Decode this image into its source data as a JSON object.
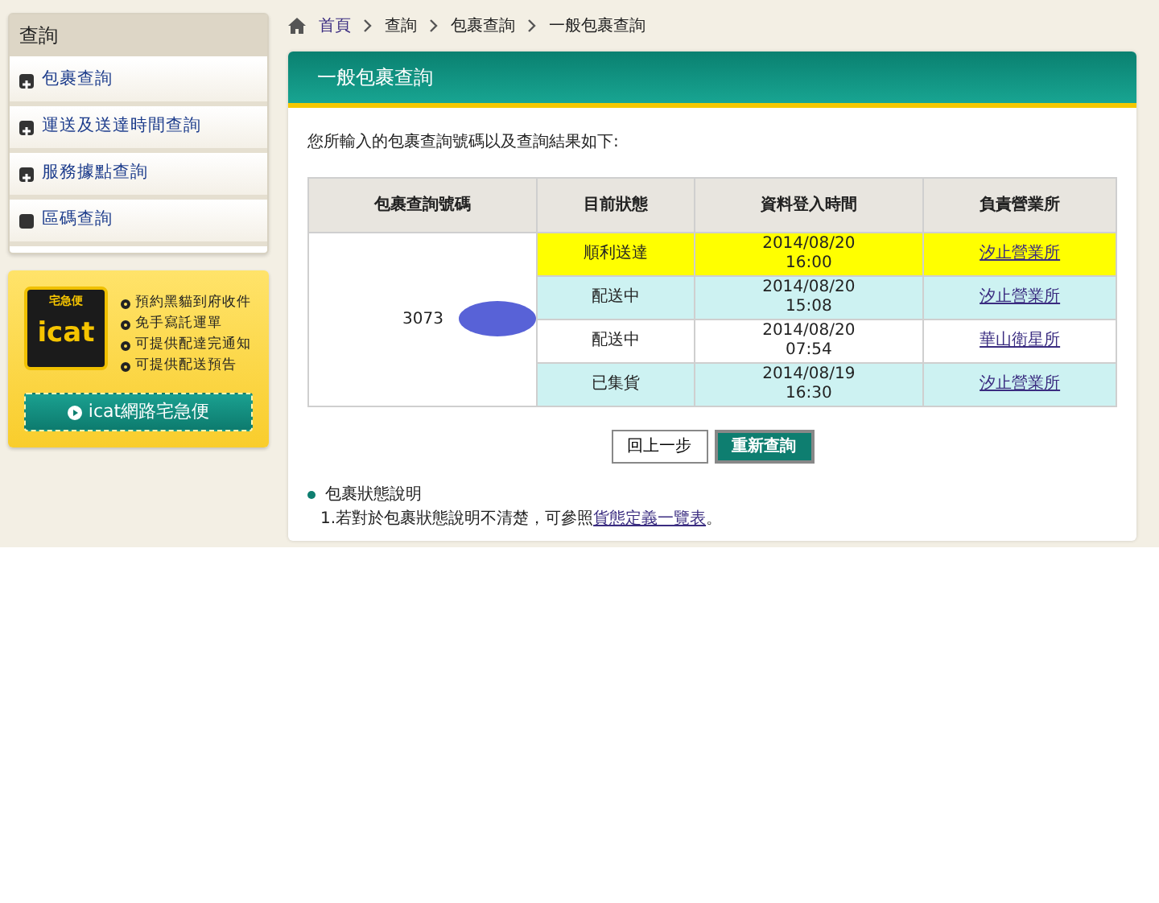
{
  "sidebar": {
    "title": "查詢",
    "items": [
      {
        "label": "包裹查詢",
        "expandable": true
      },
      {
        "label": "運送及送達時間查詢",
        "expandable": true
      },
      {
        "label": "服務據點查詢",
        "expandable": true
      },
      {
        "label": "區碼查詢",
        "expandable": false
      }
    ]
  },
  "promo": {
    "brand": "宅急便",
    "logo_text": "icat",
    "features": [
      "預約黑貓到府收件",
      "免手寫託運單",
      "可提供配達完通知",
      "可提供配送預告"
    ],
    "button": "icat網路宅急便"
  },
  "breadcrumb": [
    {
      "label": "首頁",
      "link": true
    },
    {
      "label": "查詢",
      "link": false
    },
    {
      "label": "包裹查詢",
      "link": false
    },
    {
      "label": "一般包裹查詢",
      "link": false
    }
  ],
  "panel": {
    "title": "一般包裹查詢",
    "intro": "您所輸入的包裹查詢號碼以及查詢結果如下:",
    "table": {
      "columns": [
        "包裹查詢號碼",
        "目前狀態",
        "資料登入時間",
        "負責營業所"
      ],
      "tracking_number": "3073",
      "rows": [
        {
          "status": "順利送達",
          "date": "2014/08/20",
          "time": "16:00",
          "office": "汐止營業所",
          "color": "#ffff00"
        },
        {
          "status": "配送中",
          "date": "2014/08/20",
          "time": "15:08",
          "office": "汐止營業所",
          "color": "#cdf2f2"
        },
        {
          "status": "配送中",
          "date": "2014/08/20",
          "time": "07:54",
          "office": "華山衛星所",
          "color": "#ffffff"
        },
        {
          "status": "已集貨",
          "date": "2014/08/19",
          "time": "16:30",
          "office": "汐止營業所",
          "color": "#cdf2f2"
        }
      ]
    },
    "buttons": [
      {
        "label": "回上一步",
        "kind": "secondary"
      },
      {
        "label": "重新查詢",
        "kind": "primary"
      }
    ],
    "notes": {
      "title": "包裹狀態說明",
      "line_prefix": "1.若對於包裹狀態說明不清楚，可參照",
      "link": "貨態定義一覽表",
      "line_suffix": "。"
    }
  }
}
